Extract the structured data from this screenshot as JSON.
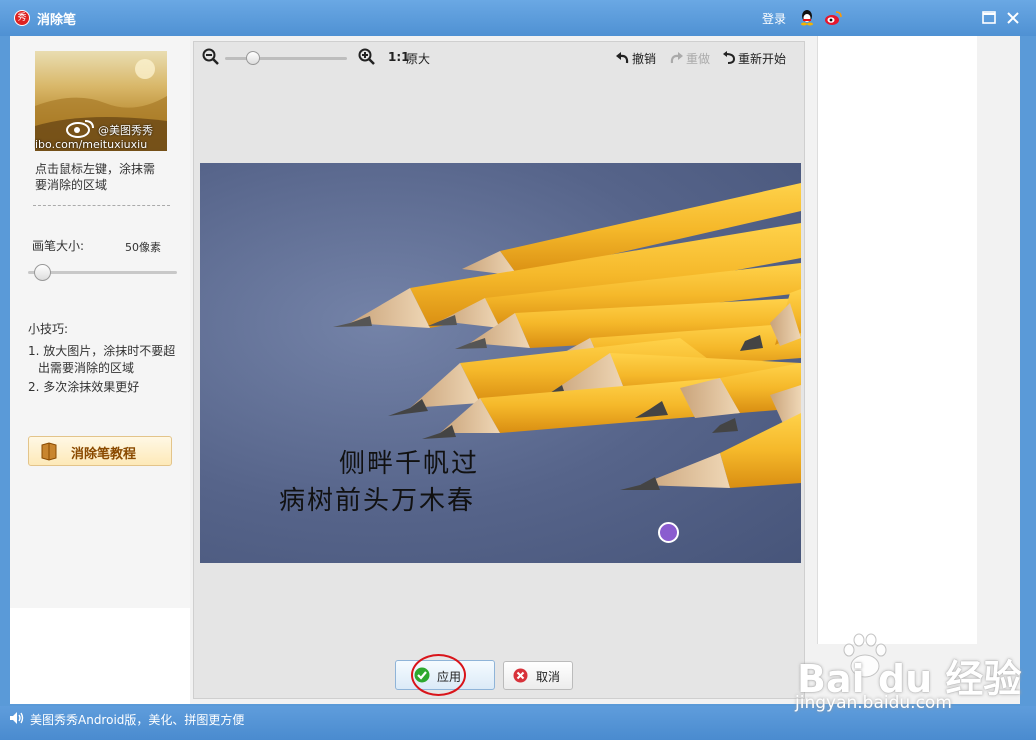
{
  "window": {
    "title": "消除笔",
    "logo_glyph": "秀",
    "login": "登录",
    "icons": [
      "qq-icon",
      "weibo-icon",
      "maximize-icon",
      "close-icon"
    ]
  },
  "left_panel": {
    "thumbnail_watermark_handle": "@美图秀秀",
    "thumbnail_watermark_url": "ibo.com/meituxiuxiu",
    "instruction_line1": "点击鼠标左键，涂抹需",
    "instruction_line2": "要消除的区域",
    "brush_size_label": "画笔大小:",
    "brush_size_value": "50像素",
    "brush_size_slider_fraction": 0.08,
    "tips_title": "小技巧:",
    "tip1_line1": "1. 放大图片，涂抹时不要超",
    "tip1_line2": "出需要消除的区域",
    "tip2": "2. 多次涂抹效果更好",
    "tutorial_button": "消除笔教程"
  },
  "toolbar": {
    "zoom_slider_fraction": 0.2,
    "ratio": "1:1",
    "original": "原大",
    "undo": "撤销",
    "redo": "重做",
    "restart": "重新开始"
  },
  "canvas": {
    "poem_line1": "侧畔千帆过",
    "poem_line2": "病树前头万木春"
  },
  "actions": {
    "apply": "应用",
    "cancel": "取消"
  },
  "status": {
    "text": "美图秀秀Android版，美化、拼图更方便"
  },
  "watermark": {
    "logo": "Bai du 经验",
    "url": "jingyan.baidu.com"
  },
  "colors": {
    "title_bar": "#4f91d3",
    "accent_red": "#d9141a",
    "pencil_yellow": "#f5b82a"
  }
}
